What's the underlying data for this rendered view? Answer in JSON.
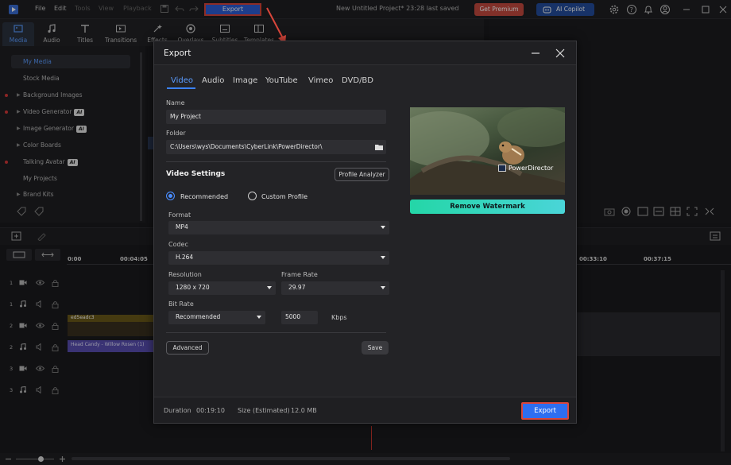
{
  "app": {
    "menu": [
      "File",
      "Edit",
      "Tools",
      "View",
      "Playback"
    ],
    "export_top": "Export",
    "project_title": "New Untitled Project* 23:28 last saved",
    "premium_label": "Get Premium",
    "copilot_label": "AI Copilot"
  },
  "media_tabs": [
    {
      "label": "Media",
      "icon": "media-icon"
    },
    {
      "label": "Audio",
      "icon": "music-note-icon"
    },
    {
      "label": "Titles",
      "icon": "title-t-icon"
    },
    {
      "label": "Transitions",
      "icon": "transitions-icon"
    },
    {
      "label": "Effects",
      "icon": "effects-icon"
    },
    {
      "label": "Overlays",
      "icon": "overlays-icon"
    },
    {
      "label": "Subtitles",
      "icon": "subtitles-icon"
    },
    {
      "label": "Templates",
      "icon": "templates-icon"
    }
  ],
  "sidebar": {
    "items": [
      {
        "label": "My Media"
      },
      {
        "label": "Stock Media"
      },
      {
        "label": "Background Images"
      },
      {
        "label": "Video Generator",
        "badge": "AI"
      },
      {
        "label": "Image Generator",
        "badge": "AI"
      },
      {
        "label": "Color Boards"
      },
      {
        "label": "Talking Avatar",
        "badge": "AI"
      },
      {
        "label": "My Projects"
      },
      {
        "label": "Brand Kits"
      }
    ]
  },
  "timeline": {
    "ticks": [
      "0:00",
      "00:04:05",
      "00:33:10",
      "00:37:15"
    ],
    "tracks": [
      "1",
      "1",
      "2",
      "2",
      "3",
      "3"
    ],
    "video_clip_label": "ed5eadc3",
    "audio_clip_label": "Head Candy - Willow Rosen (1)"
  },
  "dialog": {
    "title": "Export",
    "tabs": [
      "Video",
      "Audio",
      "Image",
      "YouTube",
      "Vimeo",
      "DVD/BD"
    ],
    "name_label": "Name",
    "name_value": "My Project",
    "folder_label": "Folder",
    "folder_value": "C:\\Users\\wys\\Documents\\CyberLink\\PowerDirector\\",
    "video_settings_label": "Video Settings",
    "profile_analyzer": "Profile Analyzer",
    "recommended": "Recommended",
    "custom_profile": "Custom Profile",
    "format_label": "Format",
    "format_value": "MP4",
    "codec_label": "Codec",
    "codec_value": "H.264",
    "resolution_label": "Resolution",
    "resolution_value": "1280 x 720",
    "frame_rate_label": "Frame Rate",
    "frame_rate_value": "29.97",
    "bit_rate_label": "Bit Rate",
    "bit_rate_value": "Recommended",
    "bit_rate_number": "5000",
    "bit_rate_unit": "Kbps",
    "advanced": "Advanced",
    "save": "Save",
    "watermark_text": "PowerDirector",
    "remove_watermark": "Remove Watermark",
    "duration_label": "Duration",
    "duration_value": "00:19:10",
    "size_label": "Size (Estimated)",
    "size_value": "12.0 MB",
    "export_button": "Export"
  },
  "colors": {
    "accent": "#3b82f6",
    "highlight_box": "#d9463b",
    "premium": "#c74b3f",
    "watermark_gradient_start": "#24d6a7"
  }
}
